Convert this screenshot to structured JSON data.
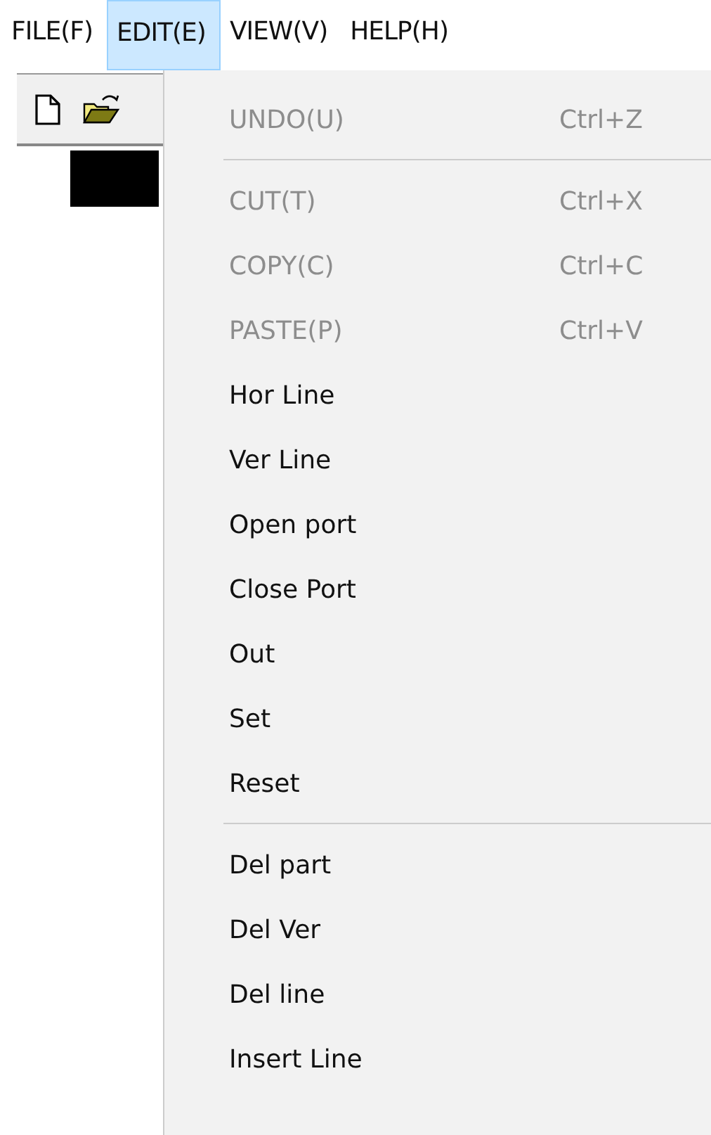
{
  "menu_bar": [
    {
      "label": "FILE(F)",
      "selected": false
    },
    {
      "label": "EDIT(E)",
      "selected": true
    },
    {
      "label": "VIEW(V)",
      "selected": false
    },
    {
      "label": "HELP(H)",
      "selected": false
    }
  ],
  "menu": {
    "items": [
      {
        "kind": "item",
        "label": "UNDO(U)",
        "shortcut": "Ctrl+Z",
        "disabled": true
      },
      {
        "kind": "separator"
      },
      {
        "kind": "item",
        "label": "CUT(T)",
        "shortcut": "Ctrl+X",
        "disabled": true
      },
      {
        "kind": "item",
        "label": "COPY(C)",
        "shortcut": "Ctrl+C",
        "disabled": true
      },
      {
        "kind": "item",
        "label": "PASTE(P)",
        "shortcut": "Ctrl+V",
        "disabled": true
      },
      {
        "kind": "item",
        "label": "Hor Line",
        "disabled": false
      },
      {
        "kind": "item",
        "label": "Ver Line",
        "disabled": false
      },
      {
        "kind": "item",
        "label": "Open port",
        "disabled": false
      },
      {
        "kind": "item",
        "label": "Close Port",
        "disabled": false
      },
      {
        "kind": "item",
        "label": "Out",
        "disabled": false
      },
      {
        "kind": "item",
        "label": "Set",
        "disabled": false
      },
      {
        "kind": "item",
        "label": "Reset",
        "disabled": false
      },
      {
        "kind": "separator"
      },
      {
        "kind": "item",
        "label": "Del part",
        "disabled": false
      },
      {
        "kind": "item",
        "label": "Del Ver",
        "disabled": false
      },
      {
        "kind": "item",
        "label": "Del line",
        "disabled": false
      },
      {
        "kind": "item",
        "label": "Insert Line",
        "disabled": false
      }
    ]
  }
}
